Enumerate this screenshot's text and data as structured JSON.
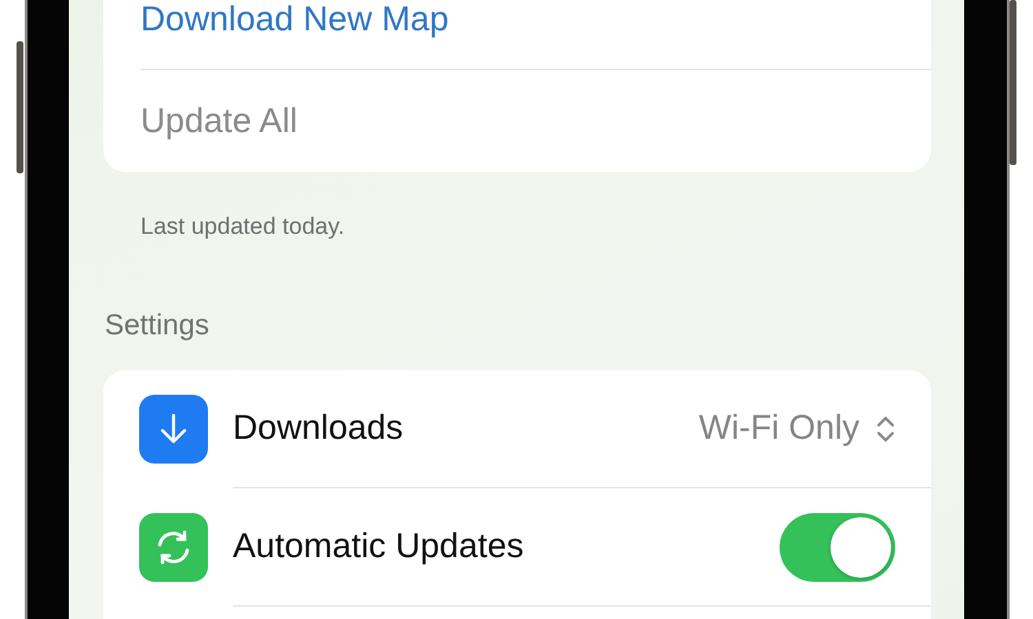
{
  "maps_card": {
    "items": [
      {
        "label": "Download New Map",
        "disabled": false,
        "kind": "link"
      },
      {
        "label": "Update All",
        "disabled": true,
        "kind": "link"
      }
    ]
  },
  "maps_footer": "Last updated today.",
  "settings": {
    "header": "Settings",
    "rows": [
      {
        "kind": "select",
        "label": "Downloads",
        "value": "Wi-Fi Only",
        "color": "#1f7bf2"
      },
      {
        "kind": "toggle",
        "label": "Automatic Updates",
        "on": true,
        "color": "#34c15a"
      }
    ]
  }
}
